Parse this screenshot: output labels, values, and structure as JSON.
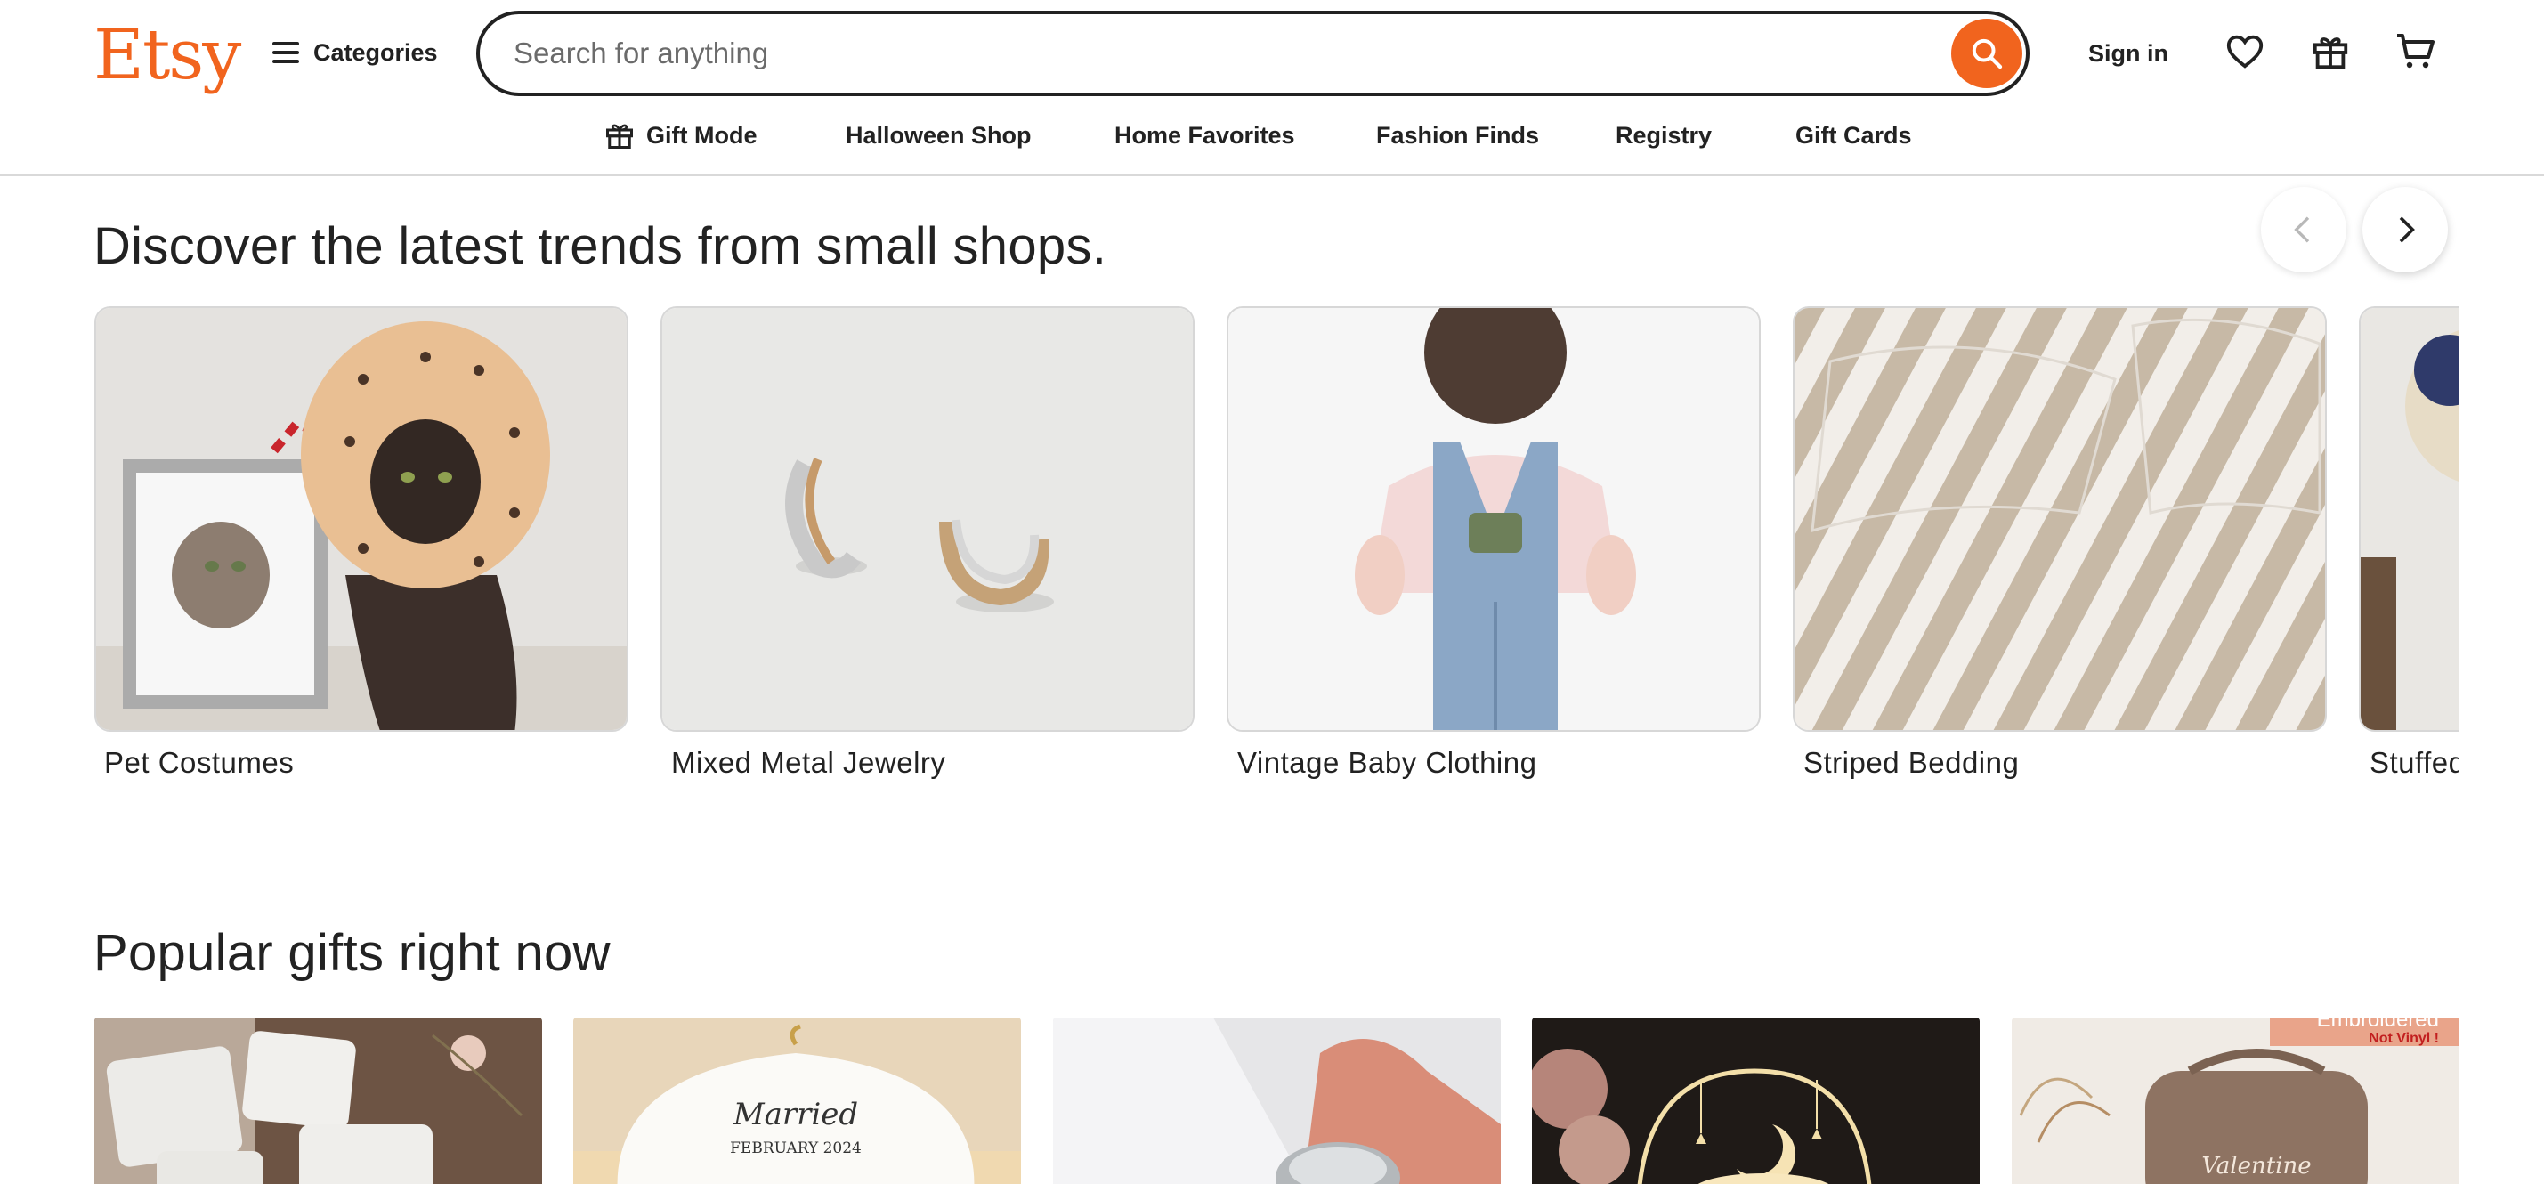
{
  "header": {
    "logo": "Etsy",
    "categories_label": "Categories",
    "search_placeholder": "Search for anything",
    "signin_label": "Sign in",
    "icons": [
      "search-icon",
      "heart-icon",
      "gift-icon",
      "cart-icon"
    ]
  },
  "nav": {
    "items": [
      {
        "label": "Gift Mode",
        "icon": "gift-icon"
      },
      {
        "label": "Halloween Shop"
      },
      {
        "label": "Home Favorites"
      },
      {
        "label": "Fashion Finds"
      },
      {
        "label": "Registry"
      },
      {
        "label": "Gift Cards"
      }
    ]
  },
  "trends": {
    "title": "Discover the latest trends from small shops.",
    "items": [
      {
        "label": "Pet Costumes"
      },
      {
        "label": "Mixed Metal Jewelry"
      },
      {
        "label": "Vintage Baby Clothing"
      },
      {
        "label": "Striped Bedding"
      },
      {
        "label": "Stuffed"
      }
    ]
  },
  "popular": {
    "title": "Popular gifts right now",
    "images": [
      {
        "caption": ""
      },
      {
        "caption": "Married",
        "subcaption": "FEBRUARY 2024"
      },
      {
        "caption": ""
      },
      {
        "caption": ""
      },
      {
        "caption": "Valentine",
        "badge_top": "Embroidered",
        "badge_bottom": "Not Vinyl !"
      }
    ]
  },
  "colors": {
    "brand": "#f1641e",
    "text": "#222222",
    "border": "#d7d7d7"
  }
}
